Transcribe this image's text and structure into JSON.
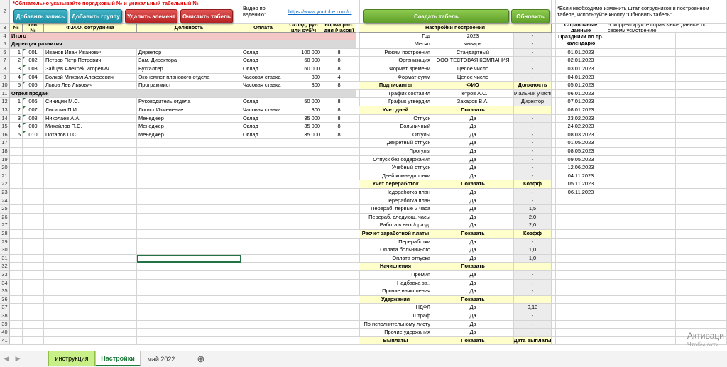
{
  "header": {
    "note_required": "*Обязательно указывайте порядковый № и уникальный табельный №",
    "video_label": "Видео по ведению:",
    "video_link": "https://www.youtube.com/cl",
    "buttons": {
      "add_record": "Добавить запись",
      "add_group": "Добавить группу",
      "delete_element": "Удалить элемент",
      "clear_table": "Очистить табель",
      "create_table": "Создать табель",
      "refresh": "Обновить"
    },
    "note_refresh": "*Если необходимо изменить штат сотрудников в построенном табеле, используйте кнопку \"Обновить табель\"",
    "note_adjust": "*Скорректируйте справочные данные по своему усмотрению"
  },
  "row_numbers": [
    "2",
    "3",
    "4",
    "5",
    "6",
    "7",
    "8",
    "9",
    "10",
    "11",
    "12",
    "13",
    "14",
    "15",
    "16",
    "17",
    "18",
    "19",
    "20",
    "21",
    "22",
    "23",
    "24",
    "25",
    "26",
    "27",
    "28",
    "29",
    "30",
    "31",
    "32",
    "33",
    "34",
    "35",
    "36",
    "37",
    "38",
    "39",
    "40",
    "41"
  ],
  "columns": {
    "num": "№",
    "tab_num": "Таб. №",
    "fio": "Ф.И.О. сотрудника",
    "position": "Должность",
    "payment": "Оплата",
    "salary": "Оклад, руб или руб/ч",
    "norm": "норма раб. дня (часов)"
  },
  "totals_label": "Итого",
  "groups": [
    {
      "name": "Дирекция развития",
      "employees": [
        {
          "num": "1",
          "tab": "001",
          "fio": "Иванов Иван Иванович",
          "position": "Директор",
          "payment": "Оклад",
          "salary": "100 000",
          "norm": "8"
        },
        {
          "num": "2",
          "tab": "002",
          "fio": "Петров Петр Петрович",
          "position": "Зам. Директора",
          "payment": "Оклад",
          "salary": "60 000",
          "norm": "8"
        },
        {
          "num": "3",
          "tab": "003",
          "fio": "Зайцев Алексей Игоревич",
          "position": "Бухгалтер",
          "payment": "Оклад",
          "salary": "60 000",
          "norm": "8"
        },
        {
          "num": "4",
          "tab": "004",
          "fio": "Волкой Михаил Алексеевич",
          "position": "Экономист планового отдела",
          "payment": "Часовая ставка",
          "salary": "300",
          "norm": "4"
        },
        {
          "num": "5",
          "tab": "005",
          "fio": "Львов Лев Львович",
          "position": "Программист",
          "payment": "Часовая ставка",
          "salary": "300",
          "norm": "8"
        }
      ]
    },
    {
      "name": "Отдел продаж",
      "employees": [
        {
          "num": "1",
          "tab": "006",
          "fio": "Синицин М.С.",
          "position": "Руководитель отдела",
          "payment": "Оклад",
          "salary": "50 000",
          "norm": "8"
        },
        {
          "num": "2",
          "tab": "007",
          "fio": "Лисицин П.И.",
          "position": "Логист Изменение",
          "payment": "Часовая ставка",
          "salary": "300",
          "norm": "8"
        },
        {
          "num": "3",
          "tab": "008",
          "fio": "Николаев А.А.",
          "position": "Менеджер",
          "payment": "Оклад",
          "salary": "35 000",
          "norm": "8"
        },
        {
          "num": "4",
          "tab": "009",
          "fio": "Михайлов П.С.",
          "position": "Менеджер",
          "payment": "Оклад",
          "salary": "35 000",
          "norm": "8"
        },
        {
          "num": "5",
          "tab": "010",
          "fio": "Потапов П.С.",
          "position": "Менеджер",
          "payment": "Оклад",
          "salary": "35 000",
          "norm": "8"
        }
      ]
    }
  ],
  "settings": {
    "title": "Настройки построения",
    "rows": [
      {
        "kind": "kv",
        "label": "Год",
        "value": "2023",
        "extra": "-"
      },
      {
        "kind": "kv",
        "label": "Месяц",
        "value": "январь",
        "extra": "-"
      },
      {
        "kind": "kv",
        "label": "Режим построения",
        "value": "Стандартный",
        "extra": "-"
      },
      {
        "kind": "kv",
        "label": "Организация",
        "value": "ООО ТЕСТОВАЯ КОМПАНИЯ",
        "extra": "-"
      },
      {
        "kind": "kv",
        "label": "Формат времени",
        "value": "Целое число",
        "extra": "-"
      },
      {
        "kind": "kv",
        "label": "Формат сумм",
        "value": "Целое число",
        "extra": "-"
      },
      {
        "kind": "section",
        "label": "Подписанты",
        "value": "ФИО",
        "extra": "Должность"
      },
      {
        "kind": "kv",
        "label": "График составил",
        "value": "Петров А.С.",
        "extra": "Начальник участка"
      },
      {
        "kind": "kv",
        "label": "График утвердил",
        "value": "Захаров В.А.",
        "extra": "Директор"
      },
      {
        "kind": "section",
        "label": "Учет дней",
        "value": "Показать",
        "extra": ""
      },
      {
        "kind": "kv",
        "label": "Отпуск",
        "value": "Да",
        "extra": "-"
      },
      {
        "kind": "kv",
        "label": "Больничный",
        "value": "Да",
        "extra": "-"
      },
      {
        "kind": "kv",
        "label": "Отгулы",
        "value": "Да",
        "extra": "-"
      },
      {
        "kind": "kv",
        "label": "Декретный отпуск",
        "value": "Да",
        "extra": "-"
      },
      {
        "kind": "kv",
        "label": "Прогулы",
        "value": "Да",
        "extra": "-"
      },
      {
        "kind": "kv",
        "label": "Отпуск без содержания",
        "value": "Да",
        "extra": "-"
      },
      {
        "kind": "kv",
        "label": "Учебный отпуск",
        "value": "Да",
        "extra": "-"
      },
      {
        "kind": "kv",
        "label": "Дней командировки",
        "value": "Да",
        "extra": "-"
      },
      {
        "kind": "section",
        "label": "Учет переработок",
        "value": "Показать",
        "extra": "Коэфф"
      },
      {
        "kind": "kv",
        "label": "Недоработка план",
        "value": "Да",
        "extra": "-"
      },
      {
        "kind": "kv",
        "label": "Переработка план",
        "value": "Да",
        "extra": "-"
      },
      {
        "kind": "kv",
        "label": "Перераб. первые 2 часа",
        "value": "Да",
        "extra": "1,5"
      },
      {
        "kind": "kv",
        "label": "Перераб. следующ. часы",
        "value": "Да",
        "extra": "2,0"
      },
      {
        "kind": "kv",
        "label": "Работа в вых./празд.",
        "value": "Да",
        "extra": "2,0"
      },
      {
        "kind": "section",
        "label": "Расчет заработной платы",
        "value": "Показать",
        "extra": "Коэфф"
      },
      {
        "kind": "kv",
        "label": "Переработки",
        "value": "Да",
        "extra": "-"
      },
      {
        "kind": "kv",
        "label": "Оплата больничного",
        "value": "Да",
        "extra": "1,0"
      },
      {
        "kind": "kv",
        "label": "Оплата отпуска",
        "value": "Да",
        "extra": "1,0"
      },
      {
        "kind": "section",
        "label": "Начисления",
        "value": "Показать",
        "extra": ""
      },
      {
        "kind": "kv",
        "label": "Премия",
        "value": "Да",
        "extra": "-"
      },
      {
        "kind": "kv",
        "label": "Надбавка за..",
        "value": "Да",
        "extra": "-"
      },
      {
        "kind": "kv",
        "label": "Прочие начисления",
        "value": "Да",
        "extra": "-"
      },
      {
        "kind": "section",
        "label": "Удержания",
        "value": "Показать",
        "extra": ""
      },
      {
        "kind": "kv",
        "label": "НДФЛ",
        "value": "Да",
        "extra": "0,13"
      },
      {
        "kind": "kv",
        "label": "Штраф",
        "value": "Да",
        "extra": "-"
      },
      {
        "kind": "kv",
        "label": "По исполнительному листу",
        "value": "Да",
        "extra": "-"
      },
      {
        "kind": "kv",
        "label": "Прочие удержания",
        "value": "Да",
        "extra": "-"
      },
      {
        "kind": "section",
        "label": "Выплаты",
        "value": "Показать",
        "extra": "Дата выплаты"
      }
    ]
  },
  "reference": {
    "title": "Справочные данные",
    "holidays_title": "Праздники по пр. календарю",
    "holidays": [
      "01.01.2023",
      "02.01.2023",
      "03.01.2023",
      "04.01.2023",
      "05.01.2023",
      "06.01.2023",
      "07.01.2023",
      "08.01.2023",
      "23.02.2023",
      "24.02.2023",
      "08.03.2023",
      "01.05.2023",
      "08.05.2023",
      "09.05.2023",
      "12.06.2023",
      "04.11.2023",
      "05.11.2023",
      "06.11.2023"
    ]
  },
  "sheet_tabs": [
    "инструкция",
    "Настройки",
    "май 2022"
  ],
  "watermark": {
    "line1": "Активаци",
    "line2": "Чтобы акти"
  },
  "colors": {
    "accent_green": "#1e7b3b",
    "header_yellow": "#ffffcc",
    "total_pink": "#f4c7c7",
    "required_red": "#e00000"
  }
}
